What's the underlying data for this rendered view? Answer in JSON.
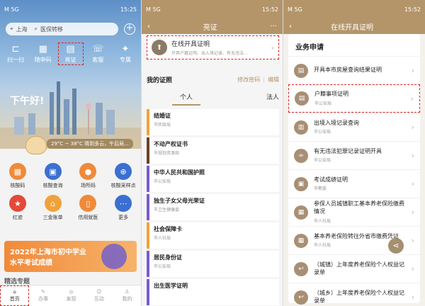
{
  "colors": {
    "accent": "#b4956a",
    "highlight": "#e02020"
  },
  "s1": {
    "status": {
      "left": "M 5G",
      "right": "15:25"
    },
    "location": "上海",
    "search_placeholder": "医保转移",
    "quick": [
      {
        "label": "扫一扫",
        "icon": "scan-icon",
        "glyph": "⊏"
      },
      {
        "label": "随申码",
        "icon": "qr-icon",
        "glyph": "▦"
      },
      {
        "label": "亮证",
        "icon": "card-icon",
        "glyph": "▤"
      },
      {
        "label": "客服",
        "icon": "headset-icon",
        "glyph": "☏"
      },
      {
        "label": "专属",
        "icon": "star-icon",
        "glyph": "✦"
      }
    ],
    "greeting": "下午好!",
    "weather": "29°C ~ 38°C  晴到多云，午后局...",
    "grid": [
      {
        "label": "核酸码",
        "color": "#f08a3a",
        "glyph": "▦"
      },
      {
        "label": "核酸查询",
        "color": "#3b6fd1",
        "glyph": "▣"
      },
      {
        "label": "场所码",
        "color": "#f08a3a",
        "glyph": "●"
      },
      {
        "label": "核酸采样点",
        "color": "#3b6fd1",
        "glyph": "⊕"
      },
      {
        "label": "红迹",
        "color": "#e24a3a",
        "glyph": "★"
      },
      {
        "label": "三金账单",
        "color": "#f0a23a",
        "glyph": "⌂"
      },
      {
        "label": "信用就医",
        "color": "#f08a3a",
        "glyph": "▯"
      },
      {
        "label": "更多",
        "color": "#3b6fd1",
        "glyph": "⋯"
      }
    ],
    "banner": {
      "line1": "2022年上海市初中学业",
      "line2": "水平考试成绩"
    },
    "cutoff_text": "精选专题",
    "tabs": [
      {
        "label": "首页",
        "icon": "home-icon",
        "glyph": "⌂"
      },
      {
        "label": "办事",
        "icon": "pen-icon",
        "glyph": "✎"
      },
      {
        "label": "发现",
        "icon": "discover-icon",
        "glyph": "◎"
      },
      {
        "label": "互动",
        "icon": "chat-icon",
        "glyph": "☺"
      },
      {
        "label": "我的",
        "icon": "user-icon",
        "glyph": "♙"
      }
    ]
  },
  "s2": {
    "status": {
      "left": "M 5G",
      "right": "15:52"
    },
    "title": "亮证",
    "card": {
      "title": "在线开具证明",
      "sub": "开具户籍证明、出入境记录、有无违法..."
    },
    "mycert": {
      "heading": "我的证照",
      "edit_password": "修改密码",
      "edit": "编辑"
    },
    "seg": {
      "personal": "个人",
      "legal": "法人"
    },
    "certs": [
      {
        "name": "结婚证",
        "org": "市民政局",
        "color": "#f0a23a"
      },
      {
        "name": "不动产权证书",
        "org": "市规划资源局",
        "color": "#6b4226"
      },
      {
        "name": "中华人民共和国护照",
        "org": "市公安局",
        "color": "#7a5bd1"
      },
      {
        "name": "独生子女父母光荣证",
        "org": "市卫生健康委",
        "color": "#7a5bd1"
      },
      {
        "name": "社会保障卡",
        "org": "市人社局",
        "color": "#f0a23a"
      },
      {
        "name": "居民身份证",
        "org": "市公安局",
        "color": "#7a5bd1"
      },
      {
        "name": "出生医学证明",
        "org": "",
        "color": "#7a5bd1"
      }
    ]
  },
  "s3": {
    "status": {
      "left": "M 5G",
      "right": "15:52"
    },
    "title": "在线开具证明",
    "section": "业务申请",
    "items": [
      {
        "title": "开具本市房屋查询结果证明",
        "org": "",
        "glyph": "▤"
      },
      {
        "title": "户籍事项证明",
        "org": "市公安局",
        "glyph": "▤"
      },
      {
        "title": "出境入境记录查询",
        "org": "市公安局",
        "glyph": "▥"
      },
      {
        "title": "有无违法犯罪记录证明开具",
        "org": "市公安局",
        "glyph": "∞"
      },
      {
        "title": "考试成绩证明",
        "org": "市教委",
        "glyph": "▣"
      },
      {
        "title": "参保人员城镇职工基本养老保险缴费情况",
        "org": "市人社局",
        "glyph": "▦"
      },
      {
        "title": "基本养老保险转往外省市缴费凭证",
        "org": "市人社局",
        "glyph": "▦"
      },
      {
        "title": "（城镇）上年度养老保险个人权益记录单",
        "org": "",
        "glyph": "↩"
      },
      {
        "title": "（城乡）上年度养老保险个人权益记录单",
        "org": "",
        "glyph": "↩"
      }
    ]
  }
}
